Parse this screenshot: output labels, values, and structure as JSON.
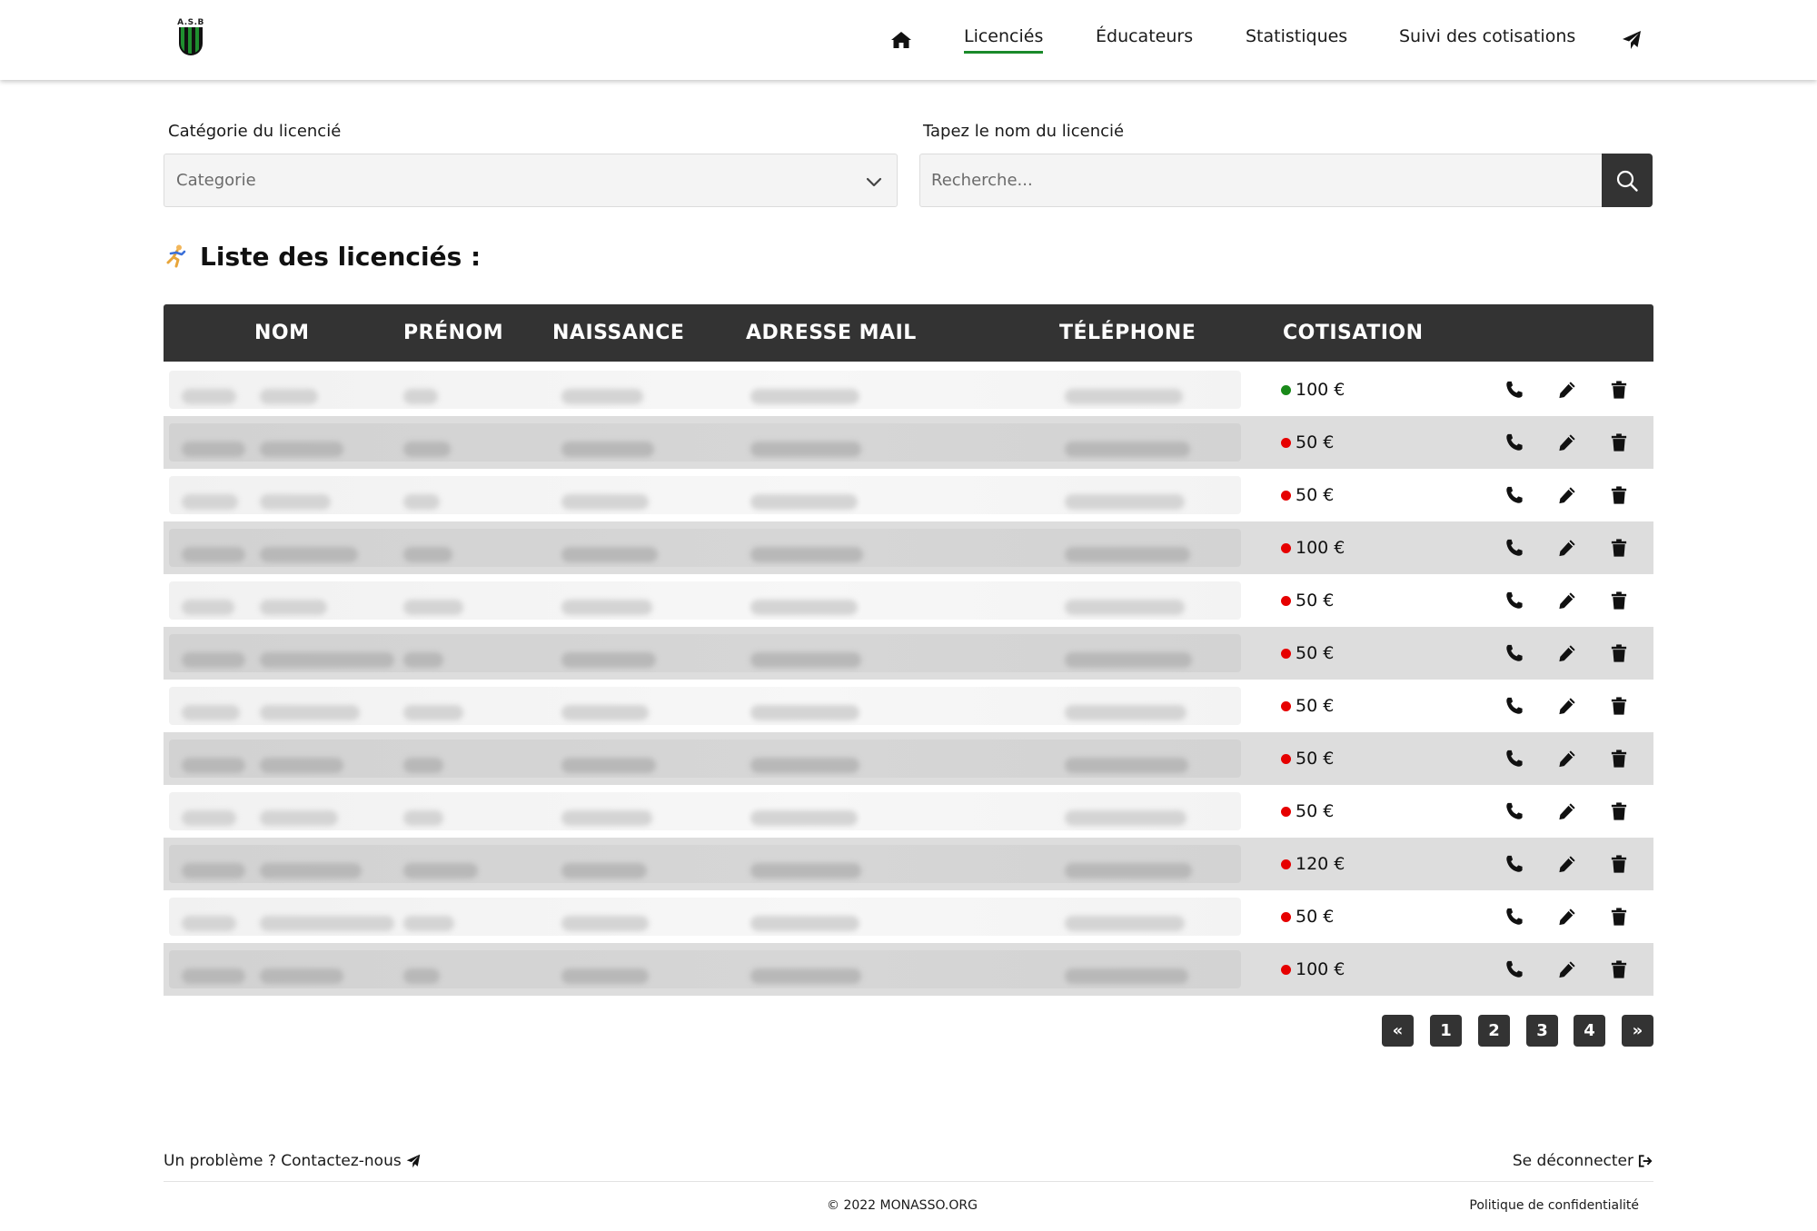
{
  "header": {
    "logo_text": "A.S.B",
    "nav": [
      {
        "label": "Licenciés",
        "active": true
      },
      {
        "label": "Éducateurs",
        "active": false
      },
      {
        "label": "Statistiques",
        "active": false
      },
      {
        "label": "Suivi des cotisations",
        "active": false
      }
    ],
    "icons": [
      "home-icon",
      "send-icon"
    ]
  },
  "filters": {
    "category_label": "Catégorie du licencié",
    "category_placeholder": "Categorie",
    "search_label": "Tapez le nom du licencié",
    "search_placeholder": "Recherche..."
  },
  "list": {
    "title": "Liste des licenciés :",
    "columns": [
      "NOM",
      "PRÉNOM",
      "NAISSANCE",
      "ADRESSE MAIL",
      "TÉLÉPHONE",
      "COTISATION"
    ],
    "rows": [
      {
        "cotisation": "100 €",
        "status": "paid"
      },
      {
        "cotisation": "50 €",
        "status": "unpaid"
      },
      {
        "cotisation": "50 €",
        "status": "unpaid"
      },
      {
        "cotisation": "100 €",
        "status": "unpaid"
      },
      {
        "cotisation": "50 €",
        "status": "unpaid"
      },
      {
        "cotisation": "50 €",
        "status": "unpaid"
      },
      {
        "cotisation": "50 €",
        "status": "unpaid"
      },
      {
        "cotisation": "50 €",
        "status": "unpaid"
      },
      {
        "cotisation": "50 €",
        "status": "unpaid"
      },
      {
        "cotisation": "120 €",
        "status": "unpaid"
      },
      {
        "cotisation": "50 €",
        "status": "unpaid"
      },
      {
        "cotisation": "100 €",
        "status": "unpaid"
      }
    ],
    "row_actions": [
      "phone-icon",
      "pencil-icon",
      "trash-icon"
    ],
    "status_colors": {
      "paid": "#1a8a1a",
      "unpaid": "#e60000"
    }
  },
  "pagination": {
    "prev": "«",
    "pages": [
      "1",
      "2",
      "3",
      "4"
    ],
    "next": "»"
  },
  "footer": {
    "contact": "Un problème ? Contactez-nous",
    "logout": "Se déconnecter",
    "copyright": "© 2022 MONASSO.ORG",
    "privacy": "Politique de confidentialité"
  },
  "colors": {
    "accent": "#1a8a2a",
    "dark": "#333333",
    "row_alt": "#dddddd"
  }
}
